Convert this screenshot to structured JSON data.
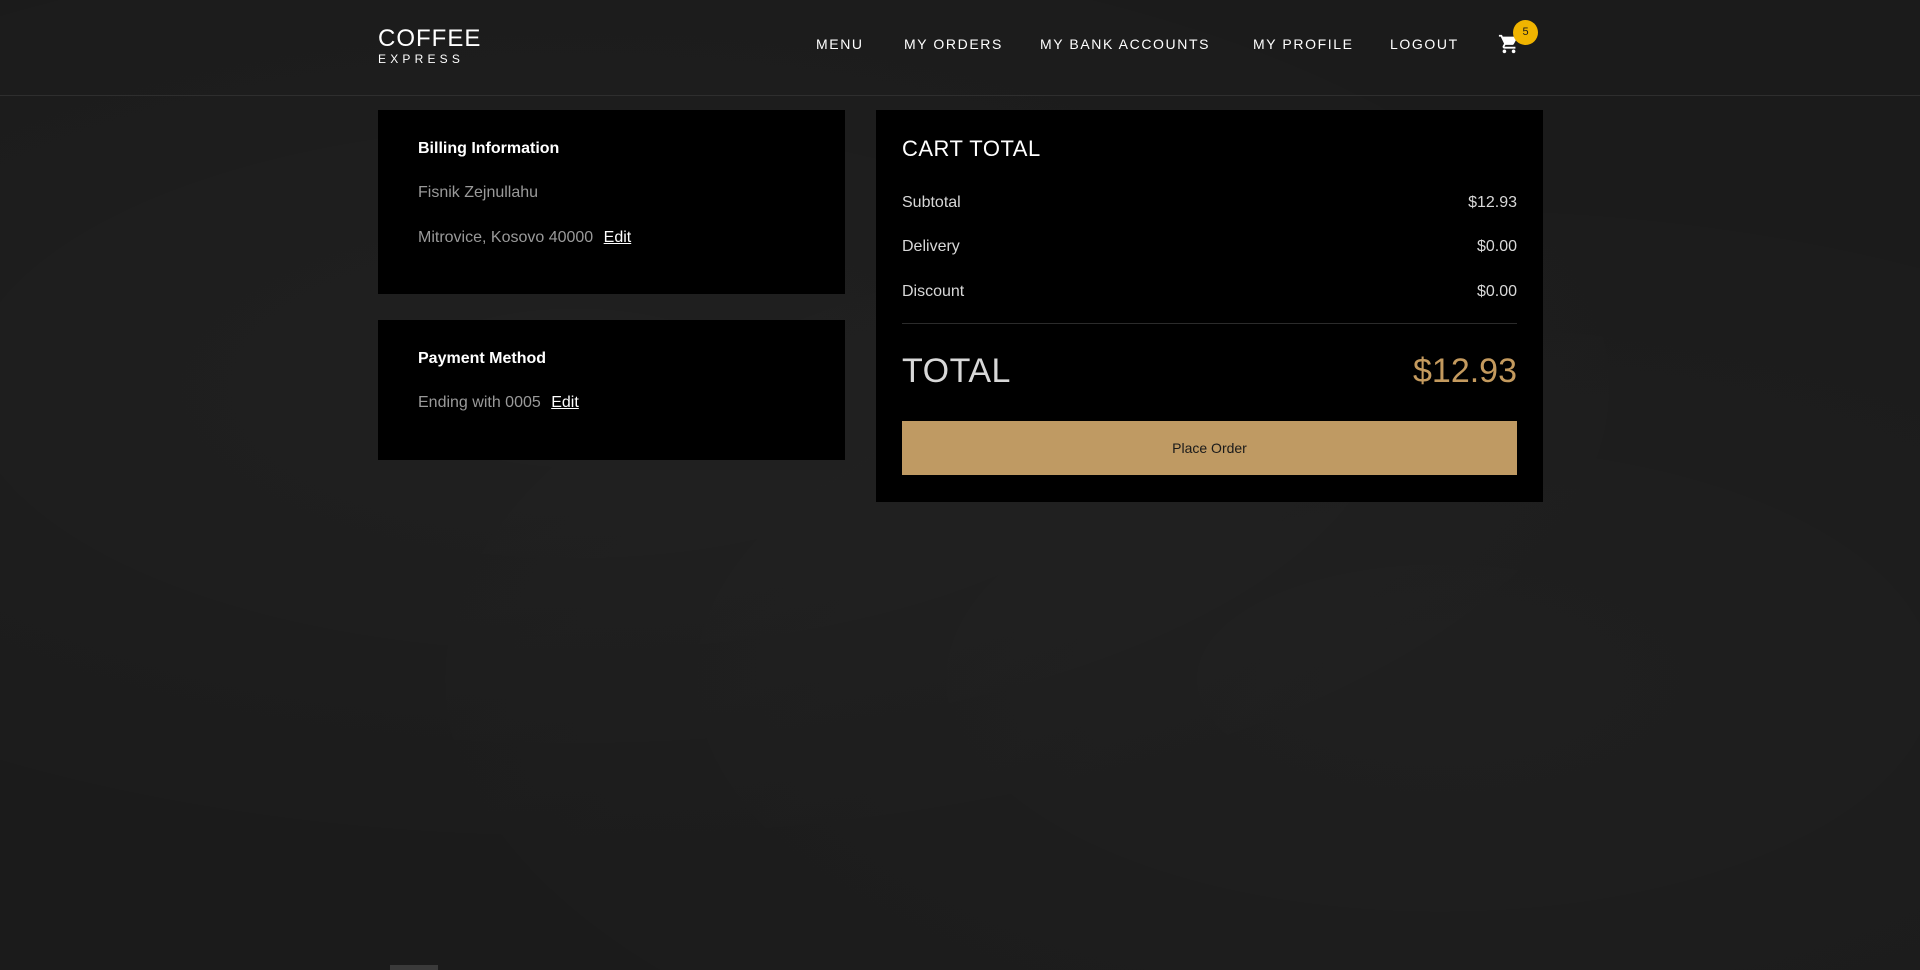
{
  "header": {
    "logo_main": "COFFEE",
    "logo_sub": "EXPRESS",
    "nav": {
      "menu": "MENU",
      "my_orders": "MY ORDERS",
      "my_bank_accounts": "MY BANK ACCOUNTS",
      "my_profile": "MY PROFILE",
      "logout": "LOGOUT"
    },
    "cart_icon": "cart-icon",
    "cart_count": "5",
    "badge_color": "#f0b400"
  },
  "billing": {
    "title": "Billing Information",
    "name": "Fisnik Zejnullahu",
    "address": "Mitrovice, Kosovo 40000",
    "edit_label": "Edit"
  },
  "payment": {
    "title": "Payment Method",
    "card": "Ending with 0005",
    "edit_label": "Edit"
  },
  "cart_total": {
    "title": "CART TOTAL",
    "rows": [
      {
        "label": "Subtotal",
        "value": "$12.93"
      },
      {
        "label": "Delivery",
        "value": "$0.00"
      },
      {
        "label": "Discount",
        "value": "$0.00"
      }
    ],
    "total_label": "TOTAL",
    "total_value": "$12.93",
    "place_order_label": "Place Order",
    "accent_color": "#bf9a63"
  }
}
